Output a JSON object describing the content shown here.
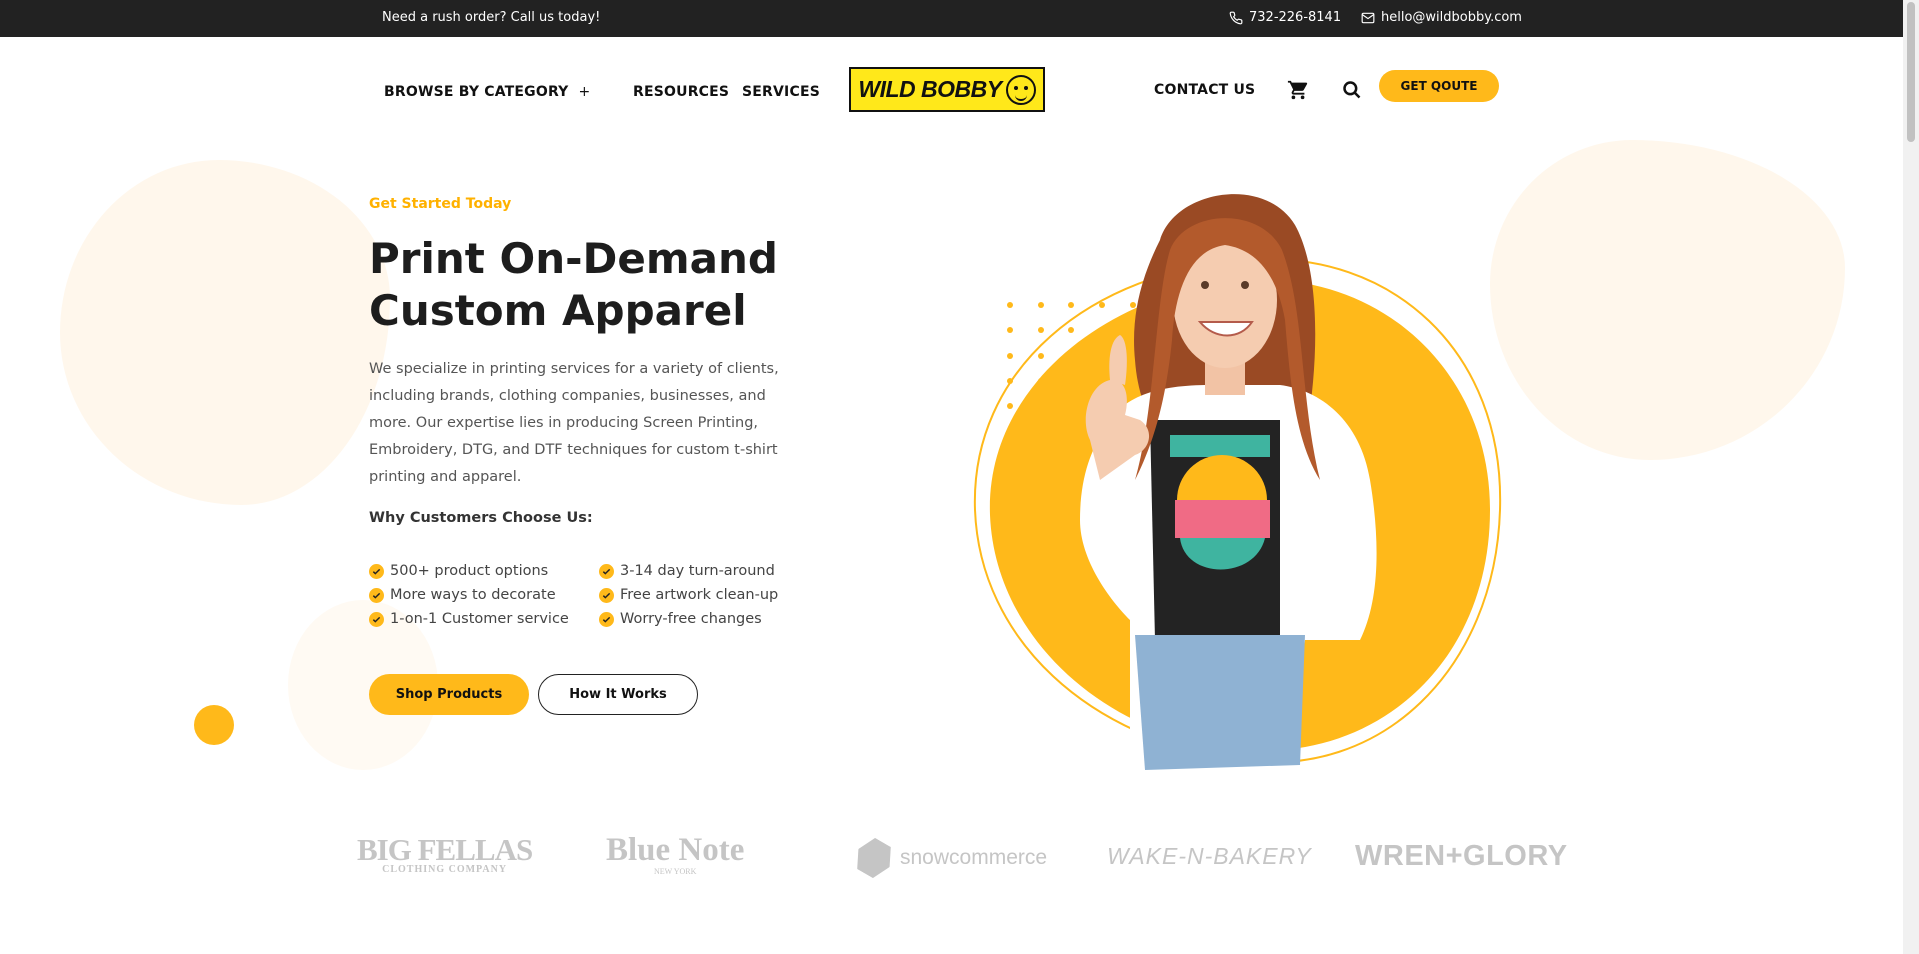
{
  "topbar": {
    "rush_text": "Need a rush order? Call us today!",
    "phone": "732-226-8141",
    "email": "hello@wildbobby.com"
  },
  "nav": {
    "browse_label": "BROWSE BY CATEGORY",
    "browse_plus": "+",
    "resources_label": "RESOURCES",
    "services_label": "SERVICES",
    "logo_text": "WILD BOBBY",
    "contact_label": "CONTACT US",
    "quote_label": "GET QOUTE"
  },
  "hero": {
    "eyebrow": "Get Started Today",
    "title": "Print On-Demand Custom Apparel",
    "description": "We specialize in printing services for a variety of clients, including brands, clothing companies, businesses, and more. Our expertise lies in producing Screen Printing, Embroidery, DTG, and DTF techniques for custom t-shirt printing and apparel.",
    "why_heading": "Why Customers Choose Us:",
    "features": [
      "500+ product options",
      "3-14 day turn-around",
      "More ways to decorate",
      "Free artwork clean-up",
      "1-on-1 Customer service",
      "Worry-free changes"
    ],
    "primary_button": "Shop Products",
    "secondary_button": "How It Works"
  },
  "brands": {
    "big_fellas": "BIG FELLAS",
    "big_fellas_sub": "CLOTHING COMPANY",
    "blue_note": "Blue Note",
    "blue_note_sub": "NEW YORK",
    "snowcommerce": "snowcommerce",
    "wake_n_bakery": "WAKE-N-BAKERY",
    "wren_glory": "WREN+GLORY"
  },
  "colors": {
    "accent": "#ffb91a",
    "topbar": "#222222",
    "eyebrow": "#ffb100",
    "blob": "#fff7ec"
  },
  "icons": [
    "phone-icon",
    "mail-icon",
    "cart-icon",
    "search-icon",
    "check-icon"
  ]
}
